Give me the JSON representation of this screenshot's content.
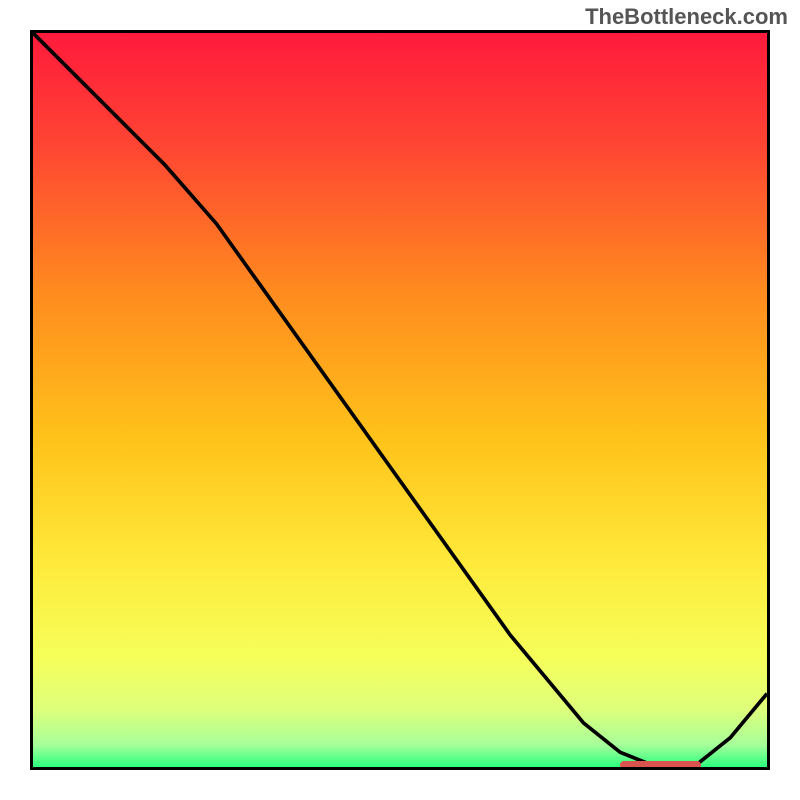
{
  "watermark": "TheBottleneck.com",
  "chart_data": {
    "type": "line",
    "title": "",
    "xlabel": "",
    "ylabel": "",
    "xlim": [
      0,
      100
    ],
    "ylim": [
      0,
      100
    ],
    "x": [
      0,
      8,
      18,
      25,
      35,
      45,
      55,
      65,
      75,
      80,
      85,
      90,
      95,
      100
    ],
    "values": [
      100,
      92,
      82,
      74,
      60,
      46,
      32,
      18,
      6,
      2,
      0,
      0,
      4,
      10
    ],
    "optimal_marker": {
      "x_start": 80,
      "x_end": 91,
      "y": 0
    },
    "gradient_stops": [
      {
        "offset": 0.0,
        "color": "#ff1a3c"
      },
      {
        "offset": 0.15,
        "color": "#ff4433"
      },
      {
        "offset": 0.35,
        "color": "#ff8a1f"
      },
      {
        "offset": 0.55,
        "color": "#ffc21a"
      },
      {
        "offset": 0.72,
        "color": "#ffe93a"
      },
      {
        "offset": 0.85,
        "color": "#f6ff5a"
      },
      {
        "offset": 0.92,
        "color": "#dfff7a"
      },
      {
        "offset": 0.97,
        "color": "#a6ff9a"
      },
      {
        "offset": 1.0,
        "color": "#2bff7e"
      }
    ]
  }
}
